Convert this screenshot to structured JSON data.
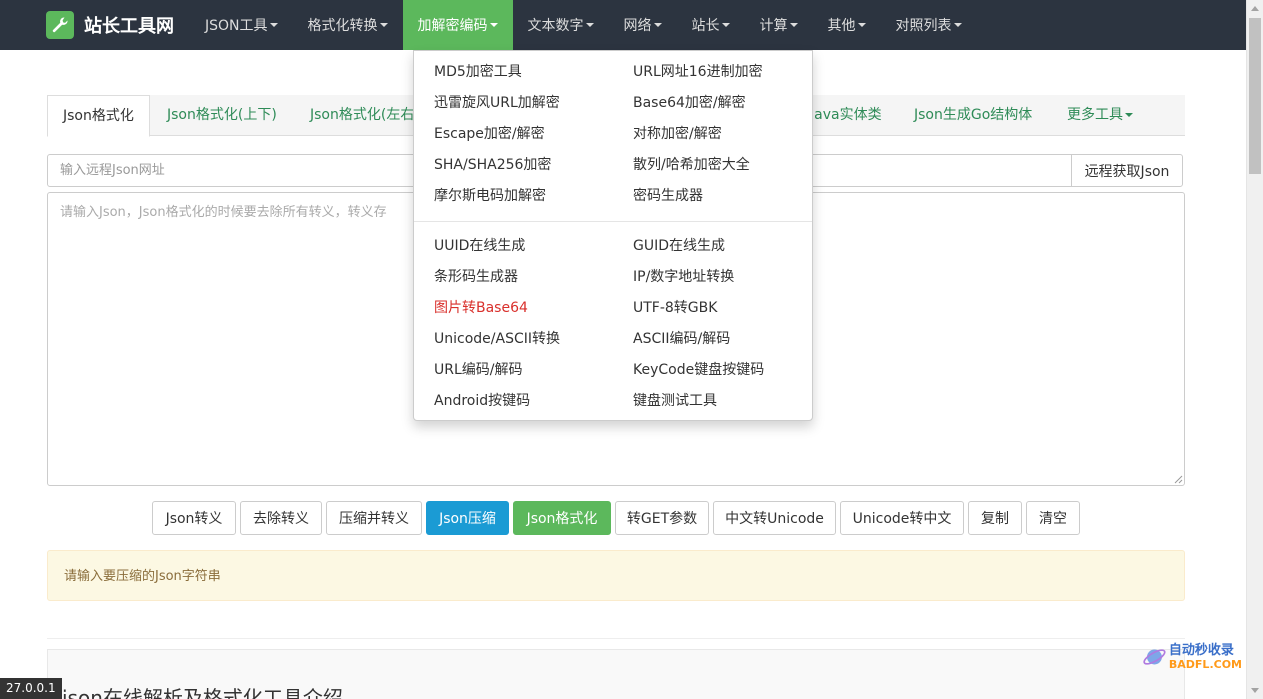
{
  "brand": {
    "name": "站长工具网"
  },
  "nav": {
    "items": [
      {
        "label": "JSON工具",
        "active": false
      },
      {
        "label": "格式化转换",
        "active": false
      },
      {
        "label": "加解密编码",
        "active": true
      },
      {
        "label": "文本数字",
        "active": false
      },
      {
        "label": "网络",
        "active": false
      },
      {
        "label": "站长",
        "active": false
      },
      {
        "label": "计算",
        "active": false
      },
      {
        "label": "其他",
        "active": false
      },
      {
        "label": "对照列表",
        "active": false
      }
    ]
  },
  "dropdown": {
    "group1": [
      [
        "MD5加密工具",
        "URL网址16进制加密"
      ],
      [
        "迅雷旋风URL加解密",
        "Base64加密/解密"
      ],
      [
        "Escape加密/解密",
        "对称加密/解密"
      ],
      [
        "SHA/SHA256加密",
        "散列/哈希加密大全"
      ],
      [
        "摩尔斯电码加解密",
        "密码生成器"
      ]
    ],
    "group2": [
      [
        "UUID在线生成",
        "GUID在线生成"
      ],
      [
        "条形码生成器",
        "IP/数字地址转换"
      ],
      [
        "图片转Base64",
        "UTF-8转GBK"
      ],
      [
        "Unicode/ASCII转换",
        "ASCII编码/解码"
      ],
      [
        "URL编码/解码",
        "KeyCode键盘按键码"
      ],
      [
        "Android按键码",
        "键盘测试工具"
      ]
    ],
    "highlight": "图片转Base64"
  },
  "tabs": {
    "t0": "Json格式化",
    "t1": "Json格式化(上下)",
    "t2": "Json格式化(左右",
    "t3": "Java实体类",
    "t4": "Json生成Go结构体",
    "t5": "更多工具"
  },
  "url_input": {
    "placeholder": "输入远程Json网址",
    "value": ""
  },
  "fetch_button": "远程获取Json",
  "json_input": {
    "placeholder": "请输入Json，Json格式化的时候要去除所有转义，转义存",
    "value": ""
  },
  "buttons": [
    {
      "label": "Json转义",
      "style": "default"
    },
    {
      "label": "去除转义",
      "style": "default"
    },
    {
      "label": "压缩并转义",
      "style": "default"
    },
    {
      "label": "Json压缩",
      "style": "info"
    },
    {
      "label": "Json格式化",
      "style": "success"
    },
    {
      "label": "转GET参数",
      "style": "default"
    },
    {
      "label": "中文转Unicode",
      "style": "default"
    },
    {
      "label": "Unicode转中文",
      "style": "default"
    },
    {
      "label": "复制",
      "style": "default"
    },
    {
      "label": "清空",
      "style": "default"
    }
  ],
  "alert": "请输入要压缩的Json字符串",
  "intro_title": "json在线解析及格式化工具介绍",
  "ip_tag": "27.0.0.1",
  "watermark": {
    "line1": "自动秒收录",
    "line2": "BADFL.COM"
  },
  "colors": {
    "nav_bg": "#2c3440",
    "accent_green": "#5cb85c",
    "info_blue": "#1b9bd4",
    "link_green": "#2e8b57",
    "alert_bg": "#fcf8e3",
    "highlight_red": "#d9302c"
  }
}
